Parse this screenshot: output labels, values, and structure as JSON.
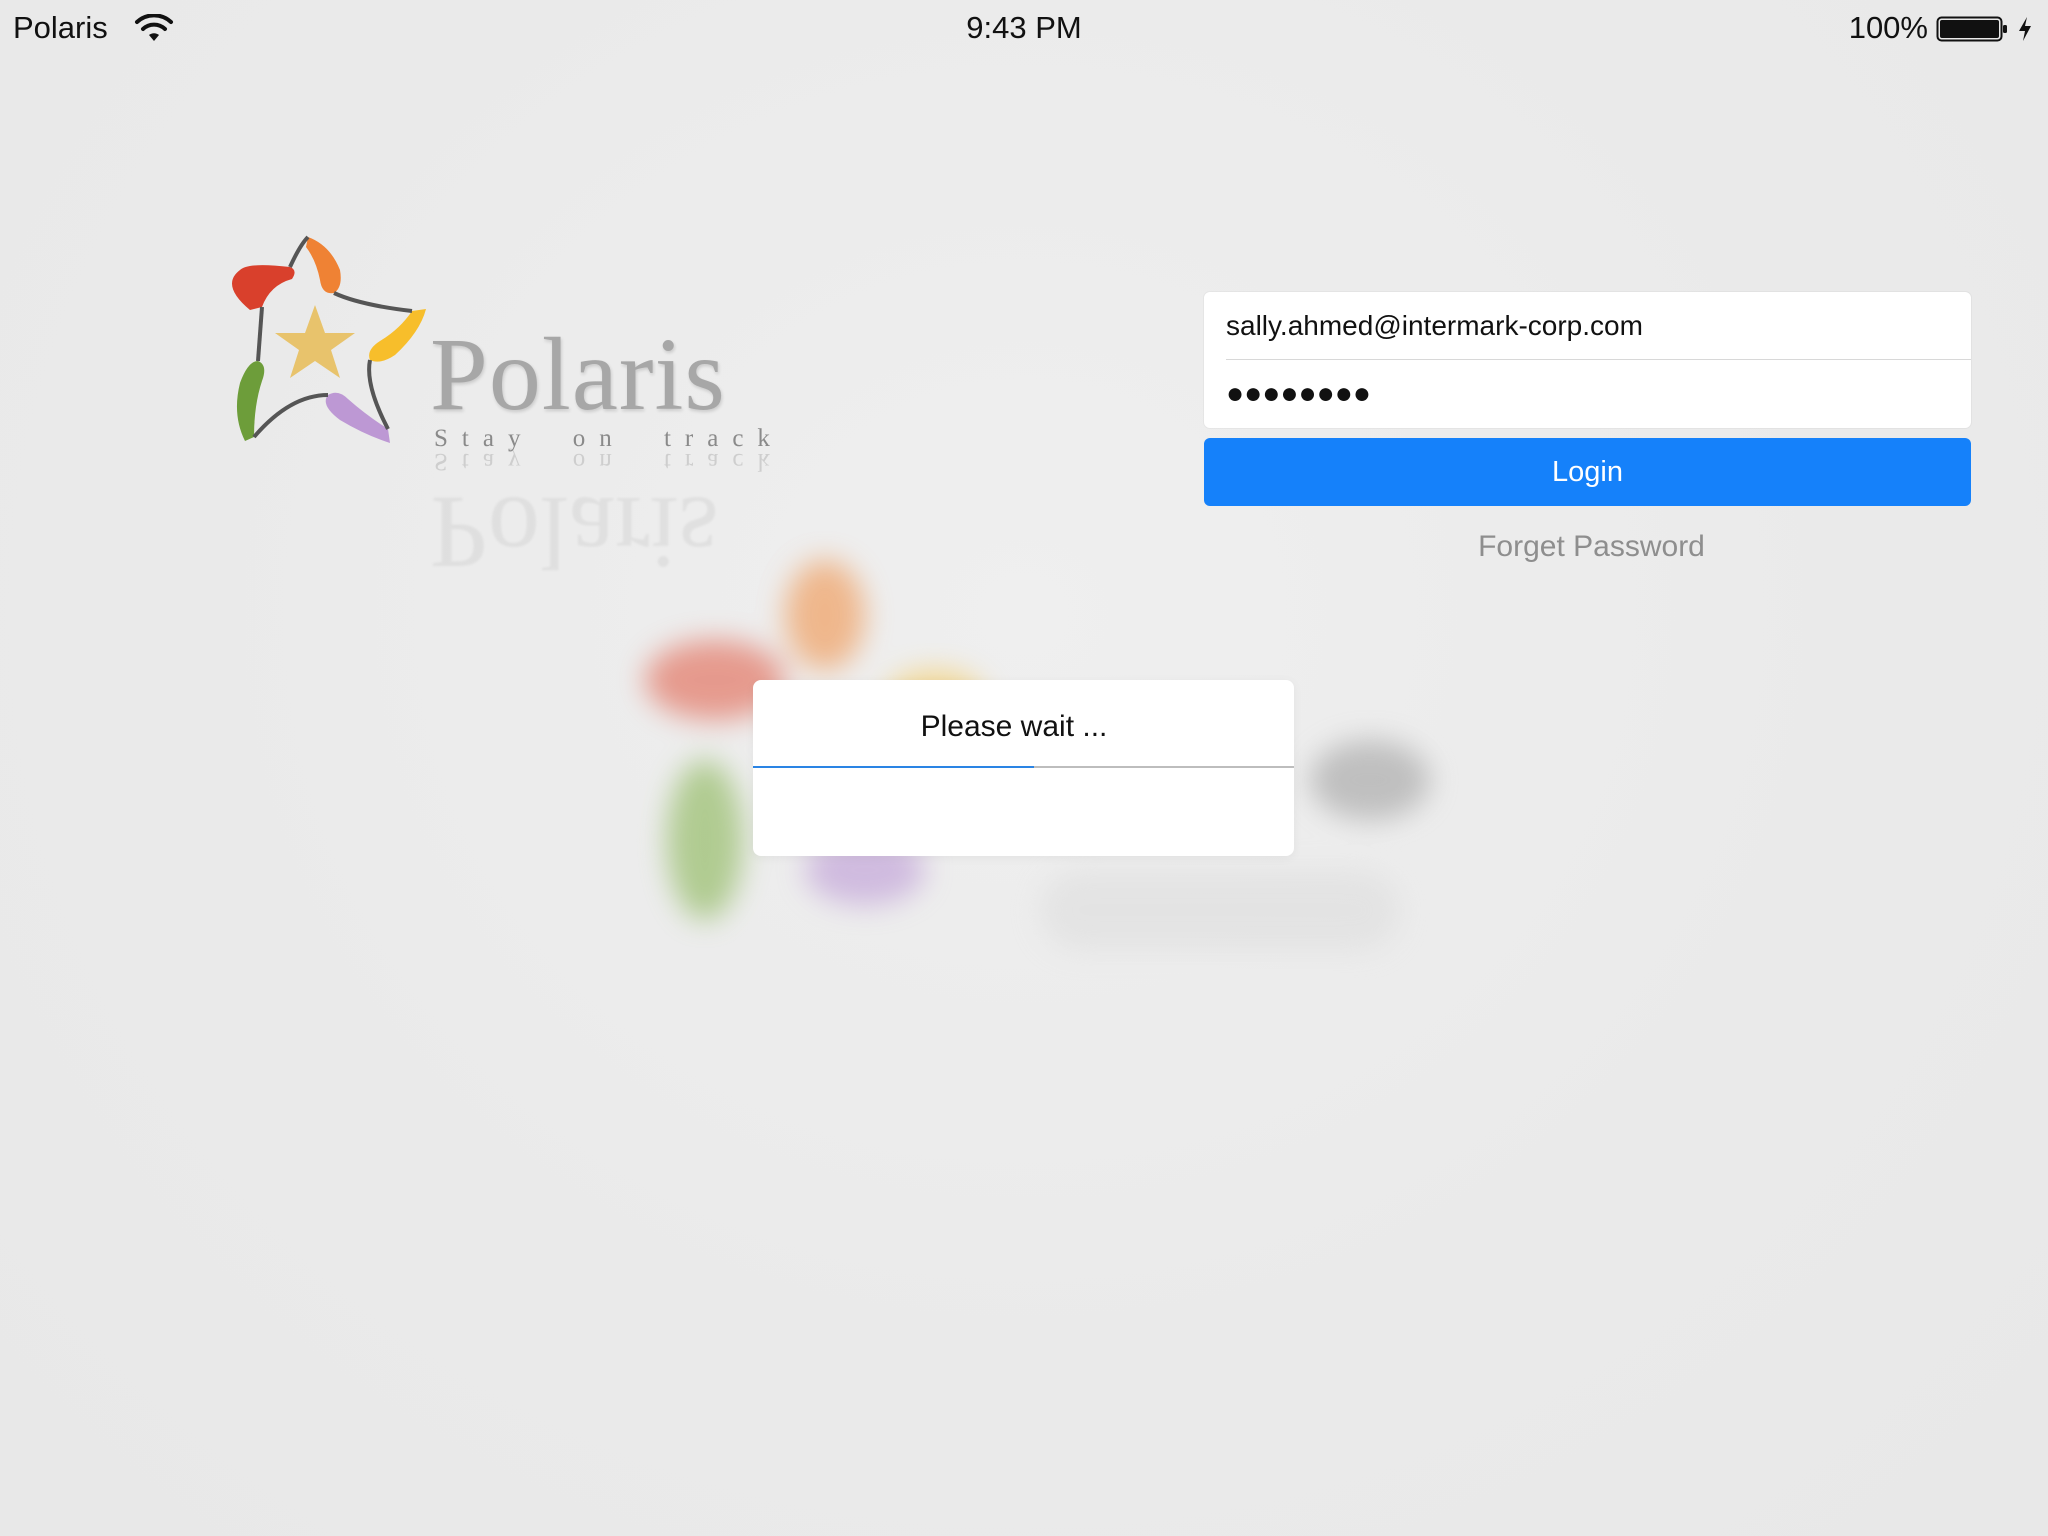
{
  "status_bar": {
    "carrier": "Polaris",
    "time": "9:43 PM",
    "battery": "100%",
    "icons": [
      "wifi-icon",
      "battery-icon",
      "charging-icon"
    ]
  },
  "logo": {
    "name": "Polaris",
    "tagline": "Stay on track"
  },
  "login": {
    "email": "sally.ahmed@intermark-corp.com",
    "password_masked": "●●●●●●●●",
    "login_label": "Login",
    "forgot_label": "Forget Password"
  },
  "dialog": {
    "title": "Please wait ...",
    "progress": 0.52
  },
  "colors": {
    "accent": "#1581fa",
    "background": "#eaeaea",
    "progress": "#2a84e4"
  }
}
